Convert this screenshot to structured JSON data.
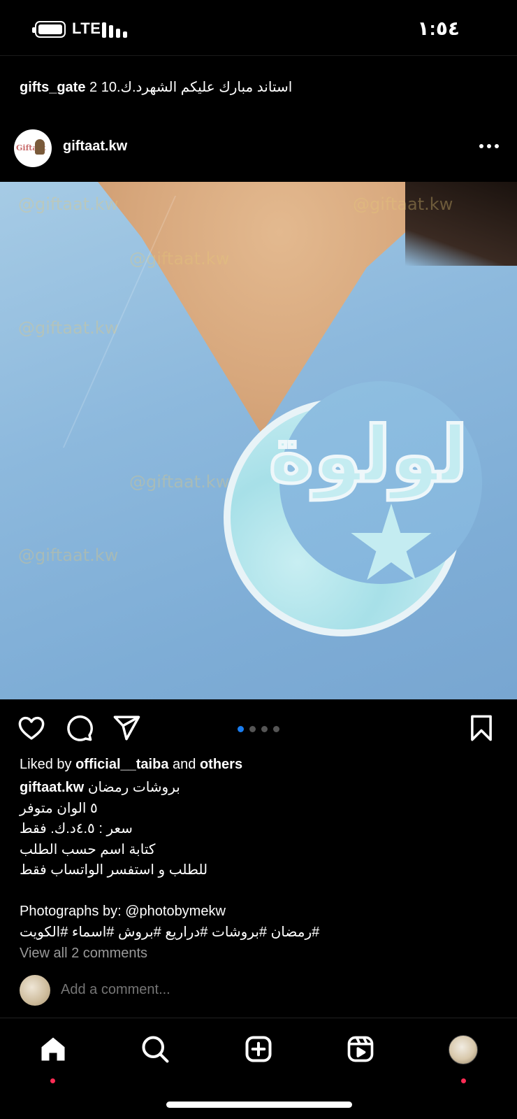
{
  "status_bar": {
    "network": "LTE",
    "time": "١:٥٤"
  },
  "previous_post": {
    "username": "gifts_gate",
    "caption": "2 10.استاند مبارك عليكم الشهرد.ك"
  },
  "post": {
    "username": "giftaat.kw",
    "avatar_logo_text": "Giftaat",
    "watermark": "@giftaat.kw",
    "brooch_text": "لولوة",
    "carousel": {
      "count": 4,
      "active_index": 0
    },
    "likes": {
      "prefix": "Liked by",
      "user": "official__taiba",
      "middle": "and",
      "suffix": "others"
    },
    "caption": {
      "username": "giftaat.kw",
      "first_line": "بروشات رمضان",
      "lines": [
        "٥ الوان متوفر",
        "سعر : ٤.٥د.ك. فقط",
        "كتابة اسم حسب الطلب",
        "للطلب و استفسر الواتساب فقط"
      ],
      "photographs": "Photographs by: @photobymekw",
      "hashtags": "#رمضان #بروشات #دراريع #بروش #اسماء #الكويت"
    },
    "view_comments": "View all 2 comments",
    "comment_placeholder": "Add a comment..."
  },
  "colors": {
    "accent_blue": "#1a7df0",
    "notification_red": "#ff2c55",
    "background": "#000000"
  },
  "tab_bar": {
    "items": [
      "home-icon",
      "search-icon",
      "create-icon",
      "reels-icon",
      "profile-avatar"
    ]
  }
}
